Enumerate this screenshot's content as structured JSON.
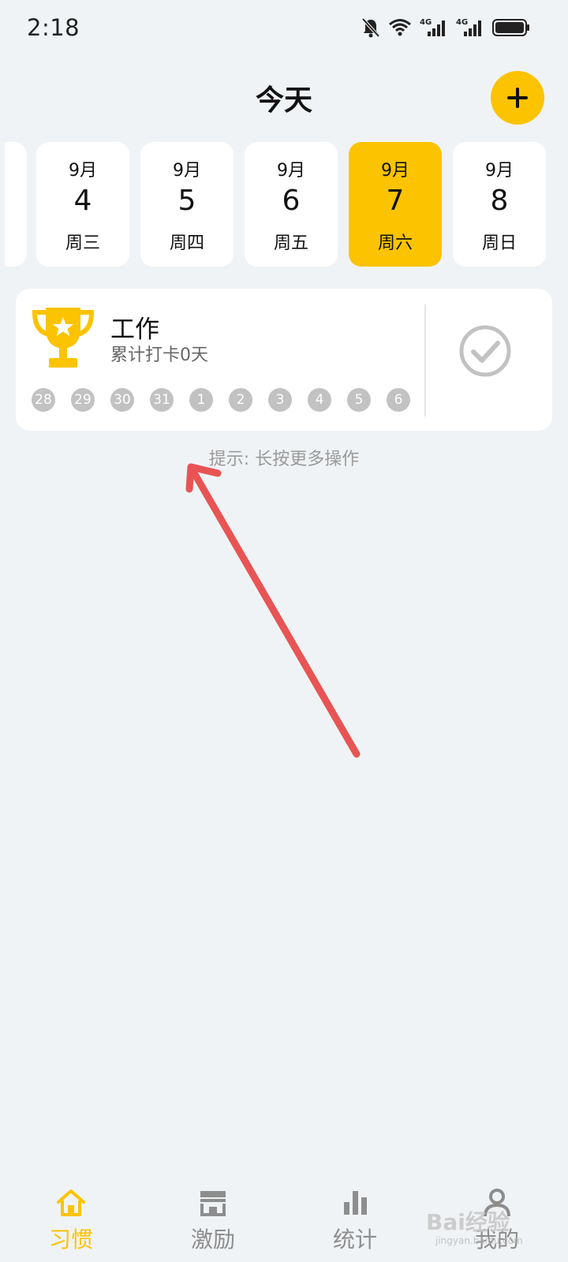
{
  "status_bar": {
    "time": "2:18",
    "icons": [
      "bell-muted-icon",
      "wifi-icon",
      "signal-4g-icon",
      "signal-4g-icon",
      "battery-icon"
    ],
    "network_label_1": "4G",
    "network_label_2": "4G"
  },
  "header": {
    "title": "今天",
    "add_icon": "plus-icon",
    "accent_color": "#fcc300"
  },
  "date_strip": {
    "days": [
      {
        "month": "9月",
        "day": "4",
        "weekday": "周三",
        "selected": false
      },
      {
        "month": "9月",
        "day": "5",
        "weekday": "周四",
        "selected": false
      },
      {
        "month": "9月",
        "day": "6",
        "weekday": "周五",
        "selected": false
      },
      {
        "month": "9月",
        "day": "7",
        "weekday": "周六",
        "selected": true
      },
      {
        "month": "9月",
        "day": "8",
        "weekday": "周日",
        "selected": false
      }
    ]
  },
  "habit": {
    "title": "工作",
    "subtitle": "累计打卡0天",
    "icon": "trophy-icon",
    "history_days": [
      "28",
      "29",
      "30",
      "31",
      "1",
      "2",
      "3",
      "4",
      "5",
      "6"
    ],
    "check_icon": "check-circle-icon"
  },
  "hint": "提示: 长按更多操作",
  "bottom_nav": {
    "items": [
      {
        "label": "习惯",
        "icon": "home-icon",
        "active": true
      },
      {
        "label": "激励",
        "icon": "shop-icon",
        "active": false
      },
      {
        "label": "统计",
        "icon": "bar-chart-icon",
        "active": false
      },
      {
        "label": "我的",
        "icon": "profile-icon",
        "active": false
      }
    ]
  },
  "watermark": {
    "text": "Bai经验",
    "sub": "jingyan.baidu.com"
  },
  "colors": {
    "background": "#f0f3f5",
    "accent": "#fcc300",
    "dot_inactive": "#c2c2c2",
    "annotation_arrow": "#e85454"
  }
}
